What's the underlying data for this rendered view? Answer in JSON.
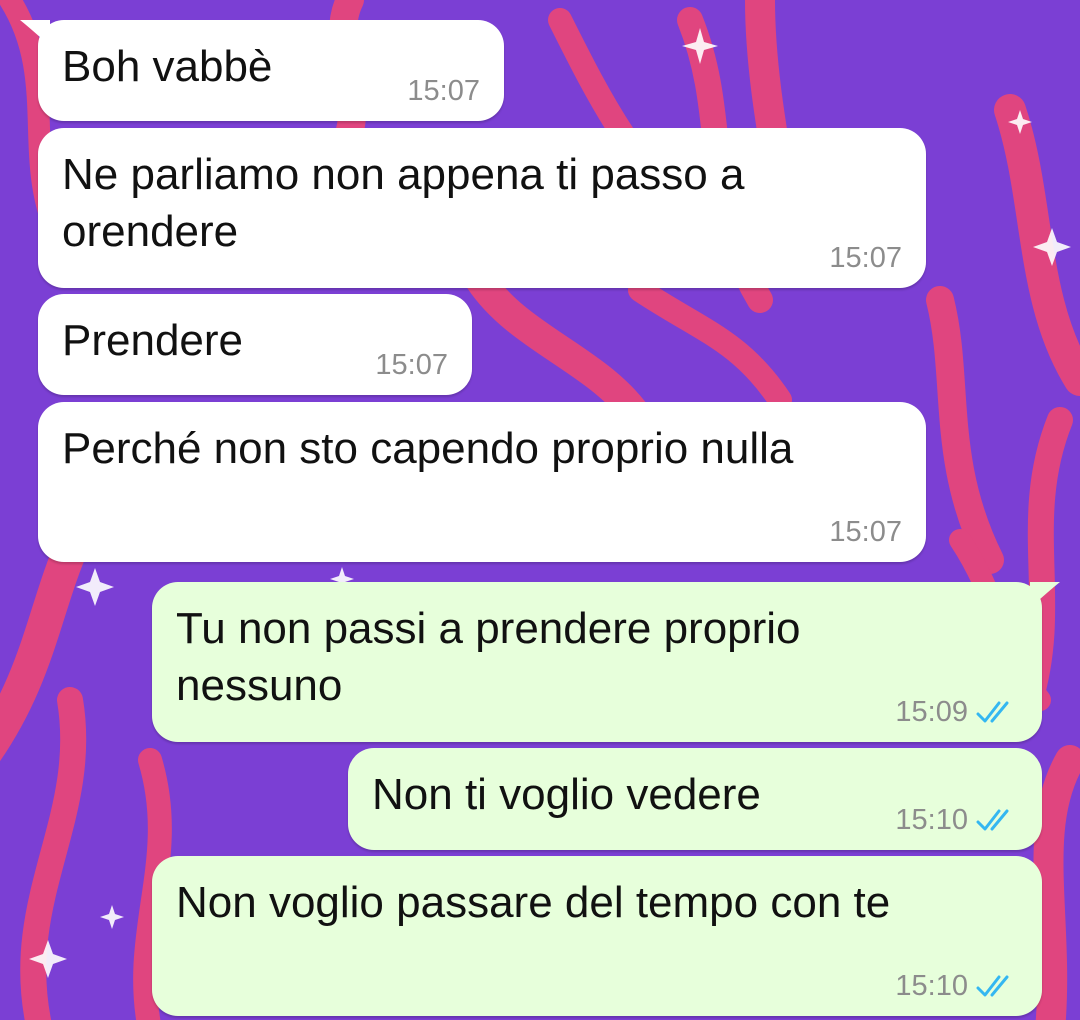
{
  "theme": {
    "incoming_bg": "#ffffff",
    "outgoing_bg": "#e7ffdb",
    "wallpaper_bg": "#7b3fd4",
    "wallpaper_flame": "#e0457f",
    "read_tick_color": "#34b7f1"
  },
  "messages": [
    {
      "direction": "incoming",
      "text": "Boh vabbè",
      "time": "15:07"
    },
    {
      "direction": "incoming",
      "text": "Ne parliamo non appena ti passo a\norendere",
      "time": "15:07"
    },
    {
      "direction": "incoming",
      "text": "Prendere",
      "time": "15:07"
    },
    {
      "direction": "incoming",
      "text": "Perché non sto capendo proprio nulla",
      "time": "15:07"
    },
    {
      "direction": "outgoing",
      "text": "Tu non passi a prendere proprio\nnessuno",
      "time": "15:09",
      "status_icon": "double-check-read-icon"
    },
    {
      "direction": "outgoing",
      "text": "Non ti voglio vedere",
      "time": "15:10",
      "status_icon": "double-check-read-icon"
    },
    {
      "direction": "outgoing",
      "text": "Non voglio passare del tempo con te",
      "time": "15:10",
      "status_icon": "double-check-read-icon"
    }
  ]
}
